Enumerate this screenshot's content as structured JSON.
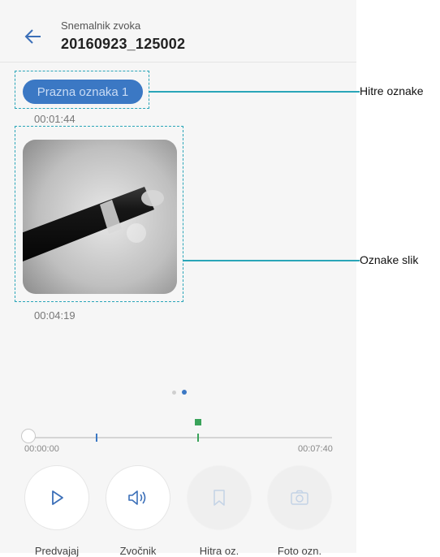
{
  "header": {
    "subtitle": "Snemalnik zvoka",
    "title": "20160923_125002"
  },
  "quick_tag": {
    "label": "Prazna oznaka 1",
    "time": "00:01:44"
  },
  "image_tag": {
    "time": "00:04:19"
  },
  "callouts": {
    "quick": "Hitre oznake",
    "image": "Oznake slik"
  },
  "player": {
    "start_time": "00:00:00",
    "end_time": "00:07:40",
    "progress": 0.0
  },
  "controls": [
    {
      "label": "Predvajaj",
      "icon": "play-icon"
    },
    {
      "label": "Zvočnik",
      "icon": "speaker-icon"
    },
    {
      "label": "Hitra oz.",
      "icon": "bookmark-icon"
    },
    {
      "label": "Foto ozn.",
      "icon": "camera-icon"
    }
  ],
  "colors": {
    "accent": "#3b78c4",
    "callout": "#2aa5b8",
    "tag_marker": "#3aa35a"
  }
}
